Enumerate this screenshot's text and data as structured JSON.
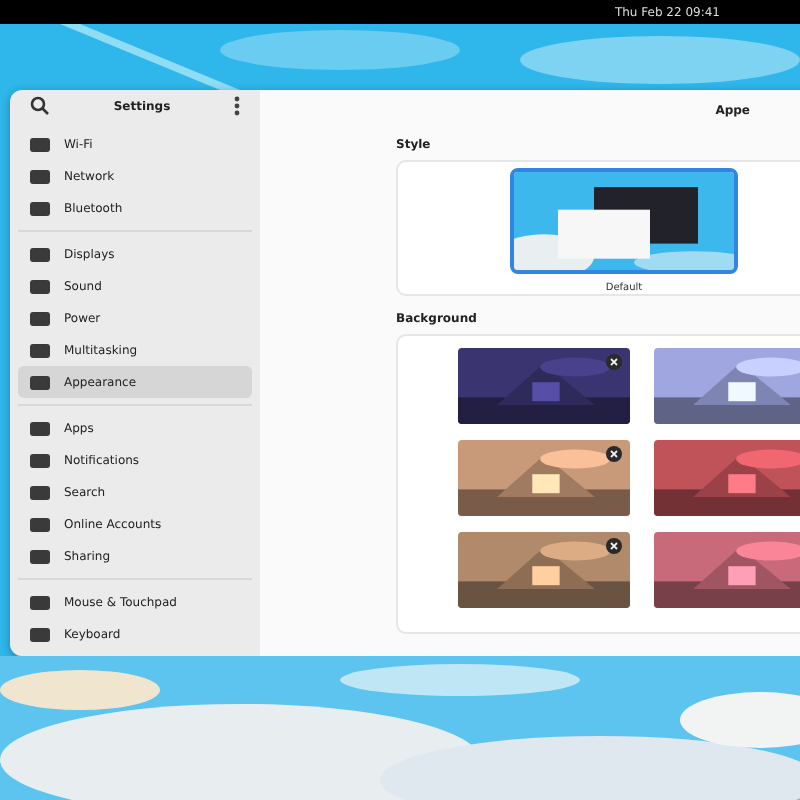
{
  "top_bar": {
    "status": "Thu Feb 22 09:41"
  },
  "window": {
    "sidebar_title": "Settings",
    "page_title": "Appe"
  },
  "sidebar": {
    "groups": [
      [
        {
          "label": "Wi-Fi",
          "selected": false
        },
        {
          "label": "Network",
          "selected": false
        },
        {
          "label": "Bluetooth",
          "selected": false
        }
      ],
      [
        {
          "label": "Displays",
          "selected": false
        },
        {
          "label": "Sound",
          "selected": false
        },
        {
          "label": "Power",
          "selected": false
        },
        {
          "label": "Multitasking",
          "selected": false
        },
        {
          "label": "Appearance",
          "selected": true
        }
      ],
      [
        {
          "label": "Apps",
          "selected": false
        },
        {
          "label": "Notifications",
          "selected": false
        },
        {
          "label": "Search",
          "selected": false
        },
        {
          "label": "Online Accounts",
          "selected": false
        },
        {
          "label": "Sharing",
          "selected": false
        }
      ],
      [
        {
          "label": "Mouse & Touchpad",
          "selected": false
        },
        {
          "label": "Keyboard",
          "selected": false
        }
      ]
    ]
  },
  "style": {
    "heading": "Style",
    "options": [
      {
        "label": "Default",
        "selected": true
      }
    ]
  },
  "background": {
    "heading": "Background"
  }
}
